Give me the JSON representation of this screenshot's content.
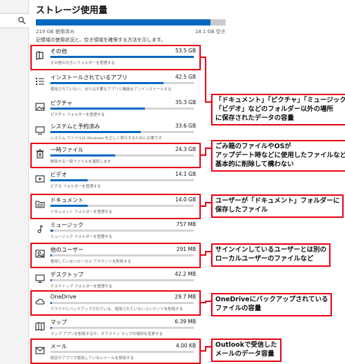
{
  "page": {
    "title": "ストレージ使用量",
    "used_label": "219 GB 使用済み",
    "free_label": "18.1 GB 空き",
    "used_fraction": 0.92,
    "description": "記憶域の使用状況と、空き領域を確保する方法を示します。"
  },
  "items": [
    {
      "name": "その他",
      "size": "53.5 GB",
      "sub": "その他の大きいフォルダーを管理する",
      "fill": 1.0,
      "icon": "folder-icon"
    },
    {
      "name": "インストールされているアプリ",
      "size": "42.5 GB",
      "sub": "使用されていない、または不要なアプリと機能をアンインストールする",
      "fill": 0.79,
      "icon": "apps-list-icon"
    },
    {
      "name": "ピクチャ",
      "size": "35.3 GB",
      "sub": "ピクチャ フォルダーを管理する",
      "fill": 0.66,
      "icon": "picture-icon"
    },
    {
      "name": "システムと予約済み",
      "size": "33.6 GB",
      "sub": "システム ファイルは Windows を正しく実行するために必要です",
      "fill": 0.63,
      "icon": "system-icon"
    },
    {
      "name": "一時ファイル",
      "size": "24.3 GB",
      "sub": "削除する一時ファイルを選択します",
      "fill": 0.45,
      "icon": "trash-icon"
    },
    {
      "name": "ビデオ",
      "size": "14.1 GB",
      "sub": "ビデオ フォルダーを管理する",
      "fill": 0.26,
      "icon": "video-icon"
    },
    {
      "name": "ドキュメント",
      "size": "14.0 GB",
      "sub": "ドキュメント フォルダーを管理する",
      "fill": 0.26,
      "icon": "documents-icon"
    },
    {
      "name": "ミュージック",
      "size": "757 MB",
      "sub": "ミュージック フォルダーを管理する",
      "fill": 0.02,
      "icon": "music-icon"
    },
    {
      "name": "他のユーザー",
      "size": "291 MB",
      "sub": "使用していないローカル アカウントを削除する",
      "fill": 0.01,
      "icon": "other-user-icon"
    },
    {
      "name": "デスクトップ",
      "size": "42.2 MB",
      "sub": "デスクトップ フォルダーを管理する",
      "fill": 0.003,
      "icon": "desktop-icon"
    },
    {
      "name": "OneDrive",
      "size": "29.7 MB",
      "sub": "クラウドにバックアップされている、使用されていないコンテンツを削除する",
      "fill": 0.002,
      "icon": "cloud-icon"
    },
    {
      "name": "マップ",
      "size": "6.39 MB",
      "sub": "マップ アプリを削除するか、オフライン マップの場所を変更する",
      "fill": 0.001,
      "icon": "map-icon"
    },
    {
      "name": "メール",
      "size": "4.00 KB",
      "sub": "既定のアプリで使用していないメールを削除する",
      "fill": 0.0,
      "icon": "mail-icon"
    }
  ],
  "callouts": [
    {
      "lines": [
        "「ドキュメント」「ピクチャ」「ミュージック」",
        "「ビデオ」などのフォルダー以外の場所",
        "に保存されたデータの容量"
      ]
    },
    {
      "lines": [
        "ごみ箱のファイルやOSが",
        "アップデート時などに使用したファイルなど。",
        "基本的に削除して構わない"
      ]
    },
    {
      "lines": [
        "ユーザーが「ドキュメント」フォルダーに",
        "保存したファイル"
      ]
    },
    {
      "lines": [
        "サインインしているユーザーとは別の",
        "ローカルユーザーのファイルなど"
      ]
    },
    {
      "lines": [
        "OneDriveにバックアップされている",
        "ファイルの容量"
      ]
    },
    {
      "lines": [
        "Outlookで受信した",
        "メールのデータ容量"
      ]
    }
  ],
  "colors": {
    "accent": "#0067c0",
    "highlight": "#e60012"
  }
}
